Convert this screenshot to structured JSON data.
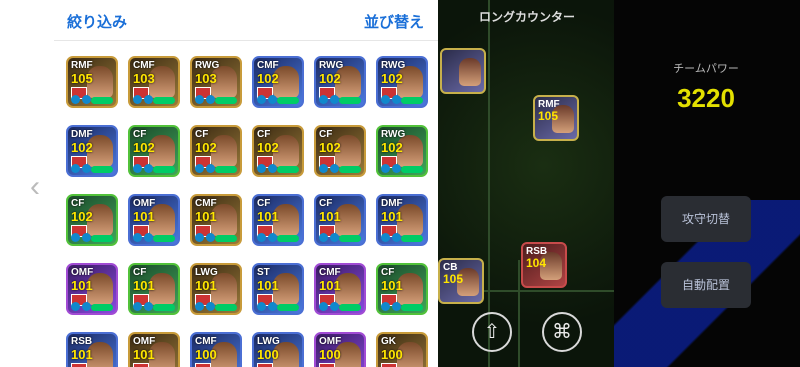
{
  "header": {
    "filter_label": "絞り込み",
    "sort_label": "並び替え"
  },
  "field": {
    "title": "ロングカウンター"
  },
  "team_power": {
    "label": "チームパワー",
    "value": "3220"
  },
  "buttons": {
    "attack_defense": "攻守切替",
    "auto_place": "自動配置"
  },
  "icons": {
    "back": "chevron-left-icon",
    "swap": "up-arrow-icon",
    "camera": "camera-icon"
  },
  "colors": {
    "accent": "#1a6fd8",
    "rating": "#ffe600",
    "team_power": "#e3e000"
  },
  "cards": [
    {
      "pos": "RMF",
      "rating": "105",
      "style": "gold"
    },
    {
      "pos": "CMF",
      "rating": "103",
      "style": "gold"
    },
    {
      "pos": "RWG",
      "rating": "103",
      "style": "gold"
    },
    {
      "pos": "CMF",
      "rating": "102",
      "style": "blue"
    },
    {
      "pos": "RWG",
      "rating": "102",
      "style": "blue"
    },
    {
      "pos": "RWG",
      "rating": "102",
      "style": "blue"
    },
    {
      "pos": "DMF",
      "rating": "102",
      "style": "blue"
    },
    {
      "pos": "CF",
      "rating": "102",
      "style": "green"
    },
    {
      "pos": "CF",
      "rating": "102",
      "style": "gold"
    },
    {
      "pos": "CF",
      "rating": "102",
      "style": "gold"
    },
    {
      "pos": "CF",
      "rating": "102",
      "style": "gold"
    },
    {
      "pos": "RWG",
      "rating": "102",
      "style": "green"
    },
    {
      "pos": "CF",
      "rating": "102",
      "style": "green"
    },
    {
      "pos": "OMF",
      "rating": "101",
      "style": "blue"
    },
    {
      "pos": "CMF",
      "rating": "101",
      "style": "gold"
    },
    {
      "pos": "CF",
      "rating": "101",
      "style": "blue"
    },
    {
      "pos": "CF",
      "rating": "101",
      "style": "blue"
    },
    {
      "pos": "DMF",
      "rating": "101",
      "style": "blue"
    },
    {
      "pos": "OMF",
      "rating": "101",
      "style": "purple"
    },
    {
      "pos": "CF",
      "rating": "101",
      "style": "green"
    },
    {
      "pos": "LWG",
      "rating": "101",
      "style": "gold"
    },
    {
      "pos": "ST",
      "rating": "101",
      "style": "blue"
    },
    {
      "pos": "CMF",
      "rating": "101",
      "style": "purple"
    },
    {
      "pos": "CF",
      "rating": "101",
      "style": "green"
    },
    {
      "pos": "RSB",
      "rating": "101",
      "style": "blue"
    },
    {
      "pos": "OMF",
      "rating": "101",
      "style": "gold"
    },
    {
      "pos": "CMF",
      "rating": "100",
      "style": "blue"
    },
    {
      "pos": "LWG",
      "rating": "100",
      "style": "blue"
    },
    {
      "pos": "OMF",
      "rating": "100",
      "style": "purple"
    },
    {
      "pos": "GK",
      "rating": "100",
      "style": "gold"
    }
  ],
  "field_cards": [
    {
      "pos": "",
      "rating": "",
      "style": "gold"
    },
    {
      "pos": "RMF",
      "rating": "105",
      "style": "gold"
    },
    {
      "pos": "CB",
      "rating": "105",
      "style": "gold"
    },
    {
      "pos": "RSB",
      "rating": "104",
      "style": "red"
    }
  ]
}
